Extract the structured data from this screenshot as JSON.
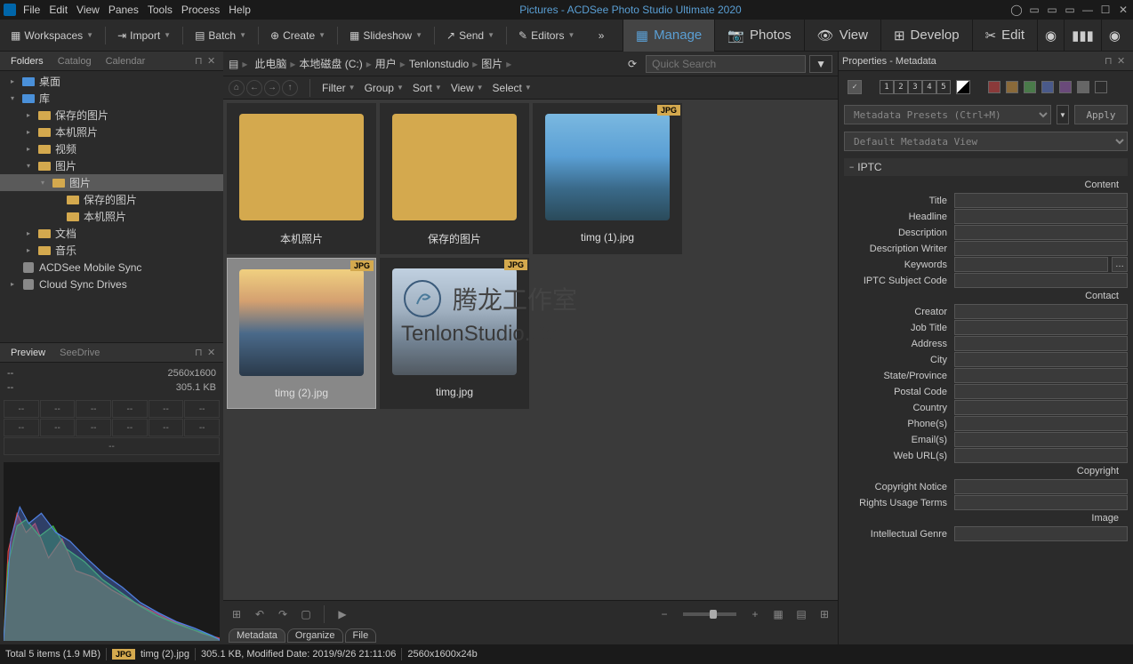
{
  "titlebar": {
    "title": "Pictures - ACDSee Photo Studio Ultimate 2020",
    "menus": [
      "File",
      "Edit",
      "View",
      "Panes",
      "Tools",
      "Process",
      "Help"
    ]
  },
  "toolbar": {
    "workspaces": "Workspaces",
    "import": "Import",
    "batch": "Batch",
    "create": "Create",
    "slideshow": "Slideshow",
    "send": "Send",
    "editors": "Editors"
  },
  "viewTabs": {
    "manage": "Manage",
    "photos": "Photos",
    "view": "View",
    "develop": "Develop",
    "edit": "Edit"
  },
  "foldersPanel": {
    "tabs": [
      "Folders",
      "Catalog",
      "Calendar"
    ],
    "tree": [
      {
        "pad": 12,
        "exp": "▸",
        "icon": "lib",
        "label": "桌面"
      },
      {
        "pad": 12,
        "exp": "▾",
        "icon": "lib",
        "label": "库"
      },
      {
        "pad": 30,
        "exp": "▸",
        "icon": "folder",
        "label": "保存的图片"
      },
      {
        "pad": 30,
        "exp": "▸",
        "icon": "folder",
        "label": "本机照片"
      },
      {
        "pad": 30,
        "exp": "▸",
        "icon": "folder",
        "label": "视频"
      },
      {
        "pad": 30,
        "exp": "▾",
        "icon": "folder",
        "label": "图片"
      },
      {
        "pad": 46,
        "exp": "▾",
        "icon": "folder",
        "label": "图片",
        "sel": true
      },
      {
        "pad": 62,
        "exp": "",
        "icon": "folder",
        "label": "保存的图片"
      },
      {
        "pad": 62,
        "exp": "",
        "icon": "folder",
        "label": "本机照片"
      },
      {
        "pad": 30,
        "exp": "▸",
        "icon": "folder",
        "label": "文档"
      },
      {
        "pad": 30,
        "exp": "▸",
        "icon": "folder",
        "label": "音乐"
      },
      {
        "pad": 12,
        "exp": "",
        "icon": "disk",
        "label": "ACDSee Mobile Sync"
      },
      {
        "pad": 12,
        "exp": "▸",
        "icon": "disk",
        "label": "Cloud Sync Drives"
      }
    ]
  },
  "previewPanel": {
    "tabs": [
      "Preview",
      "SeeDrive"
    ],
    "dimensions": "2560x1600",
    "size": "305.1 KB",
    "dash": "--"
  },
  "breadcrumb": [
    "此电脑",
    "本地磁盘 (C:)",
    "用户",
    "Tenlonstudio",
    "图片"
  ],
  "search": {
    "placeholder": "Quick Search"
  },
  "filterBar": {
    "filter": "Filter",
    "group": "Group",
    "sort": "Sort",
    "view": "View",
    "select": "Select"
  },
  "thumbs": [
    {
      "type": "folder",
      "label": "本机照片"
    },
    {
      "type": "folder",
      "label": "保存的图片"
    },
    {
      "type": "photo",
      "label": "timg (1).jpg",
      "badge": "JPG"
    },
    {
      "type": "photo2",
      "label": "timg (2).jpg",
      "badge": "JPG",
      "sel": true
    },
    {
      "type": "photo3",
      "label": "timg.jpg",
      "badge": "JPG"
    }
  ],
  "watermark": {
    "main": "腾龙工作室",
    "sub": "TenlonStudio.Com"
  },
  "properties": {
    "header": "Properties - Metadata",
    "preset": "Metadata Presets (Ctrl+M)",
    "apply": "Apply",
    "view": "Default Metadata View",
    "ratings": [
      "1",
      "2",
      "3",
      "4",
      "5"
    ],
    "section": "IPTC",
    "groups": [
      {
        "title": "Content",
        "fields": [
          "Title",
          "Headline",
          "Description",
          "Description Writer",
          "Keywords",
          "IPTC Subject Code"
        ]
      },
      {
        "title": "Contact",
        "fields": [
          "Creator",
          "Job Title",
          "Address",
          "City",
          "State/Province",
          "Postal Code",
          "Country",
          "Phone(s)",
          "Email(s)",
          "Web URL(s)"
        ]
      },
      {
        "title": "Copyright",
        "fields": [
          "Copyright Notice",
          "Rights Usage Terms"
        ]
      },
      {
        "title": "Image",
        "fields": [
          "Intellectual Genre"
        ]
      }
    ],
    "bottomTabs": [
      "Metadata",
      "Organize",
      "File"
    ]
  },
  "statusbar": {
    "total": "Total 5 items  (1.9 MB)",
    "badge": "JPG",
    "filename": "timg (2).jpg",
    "info": "305.1 KB, Modified Date: 2019/9/26 21:11:06",
    "dims": "2560x1600x24b"
  }
}
